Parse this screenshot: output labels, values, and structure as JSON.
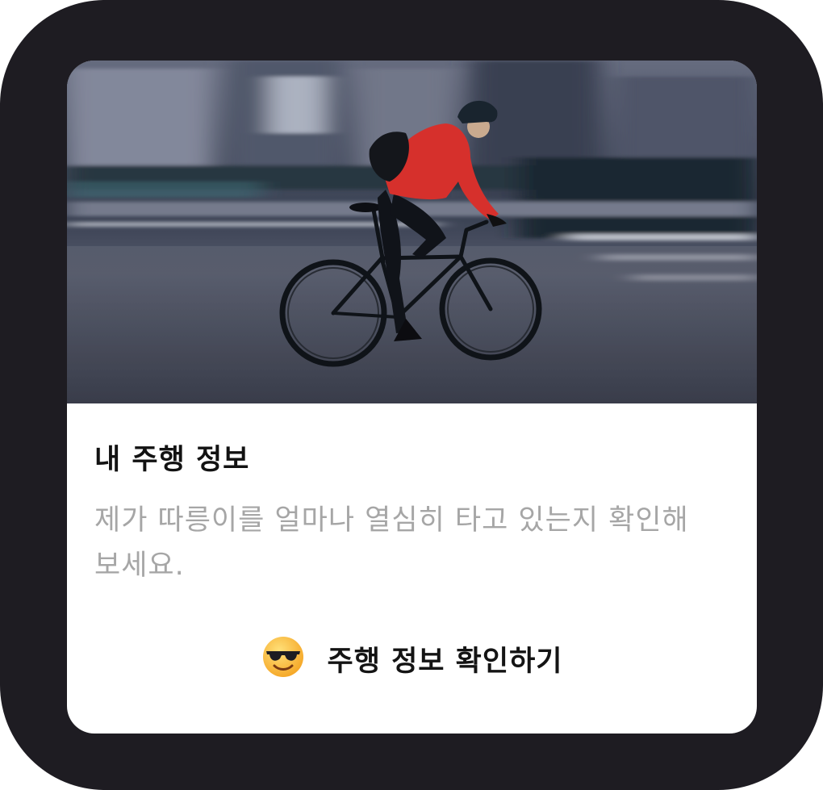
{
  "card": {
    "image_icon": "cyclist-photo",
    "title": "내 주행 정보",
    "description": "제가 따릉이를 얼마나 열심히 타고 있는지 확인해보세요.",
    "cta": {
      "icon": "sunglasses-emoji-icon",
      "label": "주행 정보 확인하기"
    }
  },
  "colors": {
    "frame": "#1e1c22",
    "card": "#ffffff",
    "title": "#121212",
    "description": "#a6a6a6",
    "jacket": "#e8342e"
  }
}
